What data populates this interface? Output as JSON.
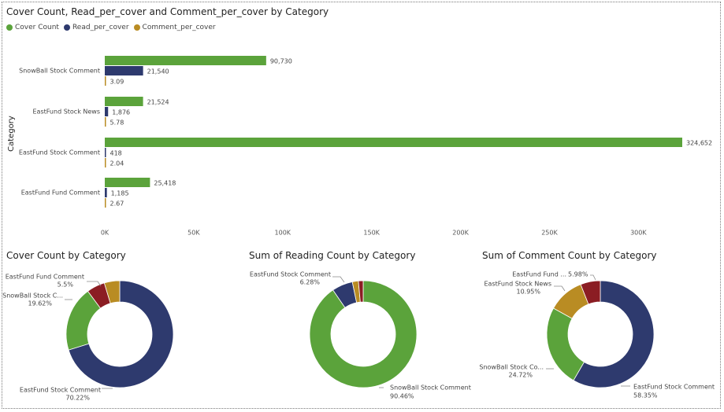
{
  "colors": {
    "green": "#5ba33b",
    "navy": "#2e3a6e",
    "gold": "#b98c23",
    "red": "#8b1d23"
  },
  "bar_chart": {
    "title": "Cover Count, Read_per_cover and Comment_per_cover by Category",
    "ylabel": "Category",
    "legend": [
      {
        "name": "Cover Count",
        "color": "#5ba33b"
      },
      {
        "name": "Read_per_cover",
        "color": "#2e3a6e"
      },
      {
        "name": "Comment_per_cover",
        "color": "#b98c23"
      }
    ]
  },
  "donut_titles": [
    "Cover Count by Category",
    "Sum of Reading Count by Category",
    "Sum of Comment Count by Category"
  ],
  "chart_data": [
    {
      "type": "bar",
      "orientation": "horizontal",
      "title": "Cover Count, Read_per_cover and Comment_per_cover by Category",
      "ylabel": "Category",
      "categories": [
        "SnowBall Stock Comment",
        "EastFund Stock News",
        "EastFund Stock Comment",
        "EastFund Fund Comment"
      ],
      "series": [
        {
          "name": "Cover Count",
          "values": [
            90730,
            21524,
            324652,
            25418
          ],
          "labels": [
            "90,730",
            "21,524",
            "324,652",
            "25,418"
          ],
          "color": "#5ba33b"
        },
        {
          "name": "Read_per_cover",
          "values": [
            21540,
            1876,
            418,
            1185
          ],
          "labels": [
            "21,540",
            "1,876",
            "418",
            "1,185"
          ],
          "color": "#2e3a6e"
        },
        {
          "name": "Comment_per_cover",
          "values": [
            3.09,
            5.78,
            2.04,
            2.67
          ],
          "labels": [
            "3.09",
            "5.78",
            "2.04",
            "2.67"
          ],
          "color": "#b98c23"
        }
      ],
      "xlim": [
        0,
        324652
      ],
      "xticks": [
        0,
        50000,
        100000,
        150000,
        200000,
        250000,
        300000
      ],
      "xtick_labels": [
        "0K",
        "50K",
        "100K",
        "150K",
        "200K",
        "250K",
        "300K"
      ],
      "legend_position": "top-left",
      "grid": false
    },
    {
      "type": "pie",
      "donut": true,
      "title": "Cover Count by Category",
      "slices": [
        {
          "category": "EastFund Stock Comment",
          "label": "EastFund Stock Comment",
          "value": 70.22,
          "pct": "70.22%",
          "color": "#2e3a6e"
        },
        {
          "category": "SnowBall Stock Comment",
          "label": "SnowBall Stock C...",
          "value": 19.62,
          "pct": "19.62%",
          "color": "#5ba33b"
        },
        {
          "category": "EastFund Fund Comment",
          "label": "EastFund Fund Comment",
          "value": 5.5,
          "pct": "5.5%",
          "color": "#8b1d23"
        },
        {
          "category": "EastFund Stock News",
          "label": "",
          "value": 4.66,
          "pct": "",
          "color": "#b98c23"
        }
      ]
    },
    {
      "type": "pie",
      "donut": true,
      "title": "Sum of Reading Count by Category",
      "slices": [
        {
          "category": "SnowBall Stock Comment",
          "label": "SnowBall Stock Comment",
          "value": 90.46,
          "pct": "90.46%",
          "color": "#5ba33b"
        },
        {
          "category": "EastFund Stock Comment",
          "label": "EastFund Stock Comment",
          "value": 6.28,
          "pct": "6.28%",
          "color": "#2e3a6e"
        },
        {
          "category": "EastFund Stock News",
          "label": "",
          "value": 1.84,
          "pct": "",
          "color": "#b98c23"
        },
        {
          "category": "EastFund Fund Comment",
          "label": "",
          "value": 1.42,
          "pct": "",
          "color": "#8b1d23"
        }
      ]
    },
    {
      "type": "pie",
      "donut": true,
      "title": "Sum of Comment Count by Category",
      "slices": [
        {
          "category": "EastFund Stock Comment",
          "label": "EastFund Stock Comment",
          "value": 58.35,
          "pct": "58.35%",
          "color": "#2e3a6e"
        },
        {
          "category": "SnowBall Stock Comment",
          "label": "SnowBall Stock Co...",
          "value": 24.72,
          "pct": "24.72%",
          "color": "#5ba33b"
        },
        {
          "category": "EastFund Stock News",
          "label": "EastFund Stock News",
          "value": 10.95,
          "pct": "10.95%",
          "color": "#b98c23"
        },
        {
          "category": "EastFund Fund Comment",
          "label": "EastFund Fund ...",
          "value": 5.98,
          "pct": "5.98%",
          "color": "#8b1d23"
        }
      ]
    }
  ]
}
